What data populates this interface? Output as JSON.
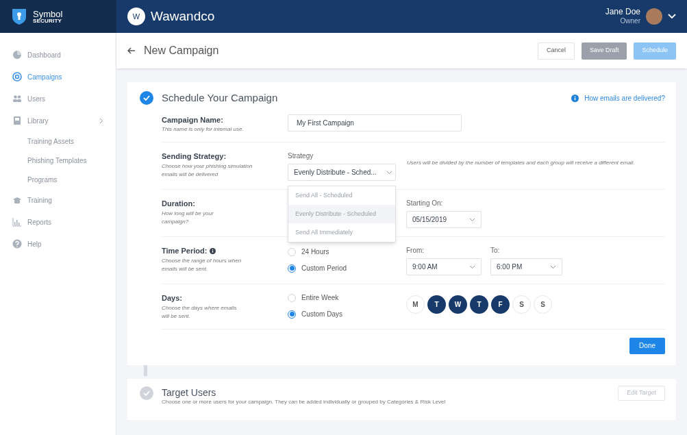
{
  "brand": {
    "name": "Symbol",
    "tagline": "SECURITY"
  },
  "org": {
    "initial": "W",
    "name": "Wawandco"
  },
  "user": {
    "name": "Jane Doe",
    "role": "Owner"
  },
  "sidebar": {
    "items": [
      {
        "label": "Dashboard",
        "kind": "pie",
        "selected": false
      },
      {
        "label": "Campaigns",
        "kind": "target",
        "selected": true
      },
      {
        "label": "Users",
        "kind": "users",
        "selected": false
      },
      {
        "label": "Library",
        "kind": "book",
        "selected": false,
        "children": [
          {
            "label": "Training Assets",
            "selected": false
          },
          {
            "label": "Phishing Templates",
            "selected": false
          },
          {
            "label": "Programs",
            "selected": false
          }
        ]
      },
      {
        "label": "Training",
        "kind": "cap",
        "selected": false
      },
      {
        "label": "Reports",
        "kind": "chart",
        "selected": false
      },
      {
        "label": "Help",
        "kind": "help",
        "selected": false
      }
    ]
  },
  "page": {
    "title": "New Campaign",
    "buttons": [
      {
        "label": "Cancel",
        "kind": "outline"
      },
      {
        "label": "Save Draft",
        "kind": "gray"
      },
      {
        "label": "Schedule",
        "kind": "disabled"
      }
    ]
  },
  "schedule": {
    "title": "Schedule Your Campaign",
    "completed": true,
    "help_link": "How emails are delivered?",
    "campaign_name": {
      "label": "Campaign Name:",
      "hint": "This name is only for internal use.",
      "value": "My First Campaign"
    },
    "strategy": {
      "label": "Sending Strategy:",
      "hint": "Choose how your phishing simulation emails will be delivered",
      "field_label": "Strategy",
      "value": "Evenly Distribute - Sched...",
      "note": "Users will be divided by the number of templates and each group will receive a different email.",
      "options": [
        {
          "label": "Send All - Scheduled",
          "selected": false
        },
        {
          "label": "Evenly Distribute - Scheduled",
          "selected": true
        },
        {
          "label": "Send All Immediately",
          "selected": false
        }
      ]
    },
    "duration": {
      "label": "Duration:",
      "hint": "How long will be your campaign?",
      "start_label": "Starting On:",
      "start_value": "05/15/2019"
    },
    "time_period": {
      "label": "Time Period:",
      "hint": "Choose the range of hours when emails will be sent.",
      "options": [
        {
          "label": "24 Hours",
          "selected": false
        },
        {
          "label": "Custom Period",
          "selected": true
        }
      ],
      "from_label": "From:",
      "from_value": "9:00 AM",
      "to_label": "To:",
      "to_value": "6:00 PM"
    },
    "days": {
      "label": "Days:",
      "hint": "Choose the days where emails will be sent.",
      "options": [
        {
          "label": "Entire Week",
          "selected": false
        },
        {
          "label": "Custom Days",
          "selected": true
        }
      ],
      "week": [
        {
          "label": "M",
          "selected": false
        },
        {
          "label": "T",
          "selected": true
        },
        {
          "label": "W",
          "selected": true
        },
        {
          "label": "T",
          "selected": true
        },
        {
          "label": "F",
          "selected": true
        },
        {
          "label": "S",
          "selected": false
        },
        {
          "label": "S",
          "selected": false
        }
      ]
    },
    "done_button": "Done"
  },
  "target": {
    "title": "Target Users",
    "completed": false,
    "description": "Choose one or more users for your campaign. They can be added individually or grouped by Categories & Risk Level",
    "button": "Edit Target"
  }
}
